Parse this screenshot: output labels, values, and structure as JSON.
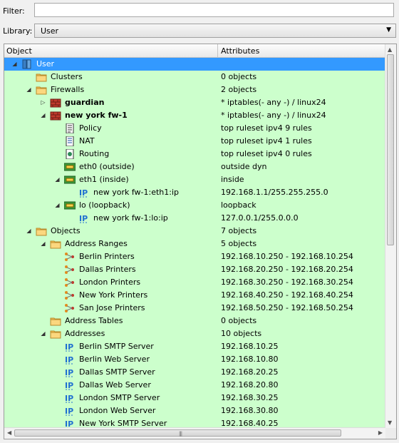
{
  "filter": {
    "label": "Filter:",
    "value": ""
  },
  "library": {
    "label": "Library:",
    "selected": "User"
  },
  "tree": {
    "columns": [
      "Object",
      "Attributes"
    ],
    "rows": [
      {
        "depth": 0,
        "toggle": "expanded",
        "icon": "library-icon",
        "label": "User",
        "attr": "",
        "selected": true
      },
      {
        "depth": 1,
        "toggle": "none",
        "icon": "folder-icon",
        "label": "Clusters",
        "attr": "0  objects"
      },
      {
        "depth": 1,
        "toggle": "expanded",
        "icon": "folder-icon",
        "label": "Firewalls",
        "attr": "2  objects"
      },
      {
        "depth": 2,
        "toggle": "collapsed",
        "icon": "firewall-icon",
        "label": "guardian",
        "attr": " * iptables(- any -) / linux24",
        "bold": true
      },
      {
        "depth": 2,
        "toggle": "expanded",
        "icon": "firewall-icon",
        "label": "new york fw-1",
        "attr": " * iptables(- any -) / linux24",
        "bold": true
      },
      {
        "depth": 3,
        "toggle": "none",
        "icon": "policy-icon",
        "label": "Policy",
        "attr": "top ruleset ipv4 9 rules"
      },
      {
        "depth": 3,
        "toggle": "none",
        "icon": "nat-icon",
        "label": "NAT",
        "attr": "top ruleset ipv4 1 rules"
      },
      {
        "depth": 3,
        "toggle": "none",
        "icon": "routing-icon",
        "label": "Routing",
        "attr": "top ruleset ipv4 0 rules"
      },
      {
        "depth": 3,
        "toggle": "none",
        "icon": "interface-icon",
        "label": "eth0 (outside)",
        "attr": "outside dyn"
      },
      {
        "depth": 3,
        "toggle": "expanded",
        "icon": "interface-icon",
        "label": "eth1 (inside)",
        "attr": "inside"
      },
      {
        "depth": 4,
        "toggle": "none",
        "icon": "ip-address-icon",
        "label": "new york fw-1:eth1:ip",
        "attr": "192.168.1.1/255.255.255.0"
      },
      {
        "depth": 3,
        "toggle": "expanded",
        "icon": "interface-icon",
        "label": "lo (loopback)",
        "attr": "loopback"
      },
      {
        "depth": 4,
        "toggle": "none",
        "icon": "ip-address-icon",
        "label": "new york fw-1:lo:ip",
        "attr": "127.0.0.1/255.0.0.0"
      },
      {
        "depth": 1,
        "toggle": "expanded",
        "icon": "folder-icon",
        "label": "Objects",
        "attr": "7  objects"
      },
      {
        "depth": 2,
        "toggle": "expanded",
        "icon": "folder-icon",
        "label": "Address Ranges",
        "attr": "5  objects"
      },
      {
        "depth": 3,
        "toggle": "none",
        "icon": "address-range-icon",
        "label": "Berlin Printers",
        "attr": "192.168.10.250 - 192.168.10.254"
      },
      {
        "depth": 3,
        "toggle": "none",
        "icon": "address-range-icon",
        "label": "Dallas Printers",
        "attr": "192.168.20.250 - 192.168.20.254"
      },
      {
        "depth": 3,
        "toggle": "none",
        "icon": "address-range-icon",
        "label": "London Printers",
        "attr": "192.168.30.250 - 192.168.30.254"
      },
      {
        "depth": 3,
        "toggle": "none",
        "icon": "address-range-icon",
        "label": "New York Printers",
        "attr": "192.168.40.250 - 192.168.40.254"
      },
      {
        "depth": 3,
        "toggle": "none",
        "icon": "address-range-icon",
        "label": "San Jose Printers",
        "attr": "192.168.50.250 - 192.168.50.254"
      },
      {
        "depth": 2,
        "toggle": "none",
        "icon": "folder-icon",
        "label": "Address Tables",
        "attr": "0  objects"
      },
      {
        "depth": 2,
        "toggle": "expanded",
        "icon": "folder-icon",
        "label": "Addresses",
        "attr": "10  objects"
      },
      {
        "depth": 3,
        "toggle": "none",
        "icon": "ip-address-icon",
        "label": "Berlin SMTP Server",
        "attr": "192.168.10.25"
      },
      {
        "depth": 3,
        "toggle": "none",
        "icon": "ip-address-icon",
        "label": "Berlin Web Server",
        "attr": "192.168.10.80"
      },
      {
        "depth": 3,
        "toggle": "none",
        "icon": "ip-address-icon",
        "label": "Dallas SMTP Server",
        "attr": "192.168.20.25"
      },
      {
        "depth": 3,
        "toggle": "none",
        "icon": "ip-address-icon",
        "label": "Dallas Web Server",
        "attr": "192.168.20.80"
      },
      {
        "depth": 3,
        "toggle": "none",
        "icon": "ip-address-icon",
        "label": "London SMTP Server",
        "attr": "192.168.30.25"
      },
      {
        "depth": 3,
        "toggle": "none",
        "icon": "ip-address-icon",
        "label": "London Web Server",
        "attr": "192.168.30.80"
      },
      {
        "depth": 3,
        "toggle": "none",
        "icon": "ip-address-icon",
        "label": "New York SMTP Server",
        "attr": "192.168.40.25"
      }
    ]
  },
  "colors": {
    "tree_background": "#ccffcc",
    "selection": "#3399ff",
    "folder": "#f7c456",
    "firewall": "#c0392b"
  }
}
